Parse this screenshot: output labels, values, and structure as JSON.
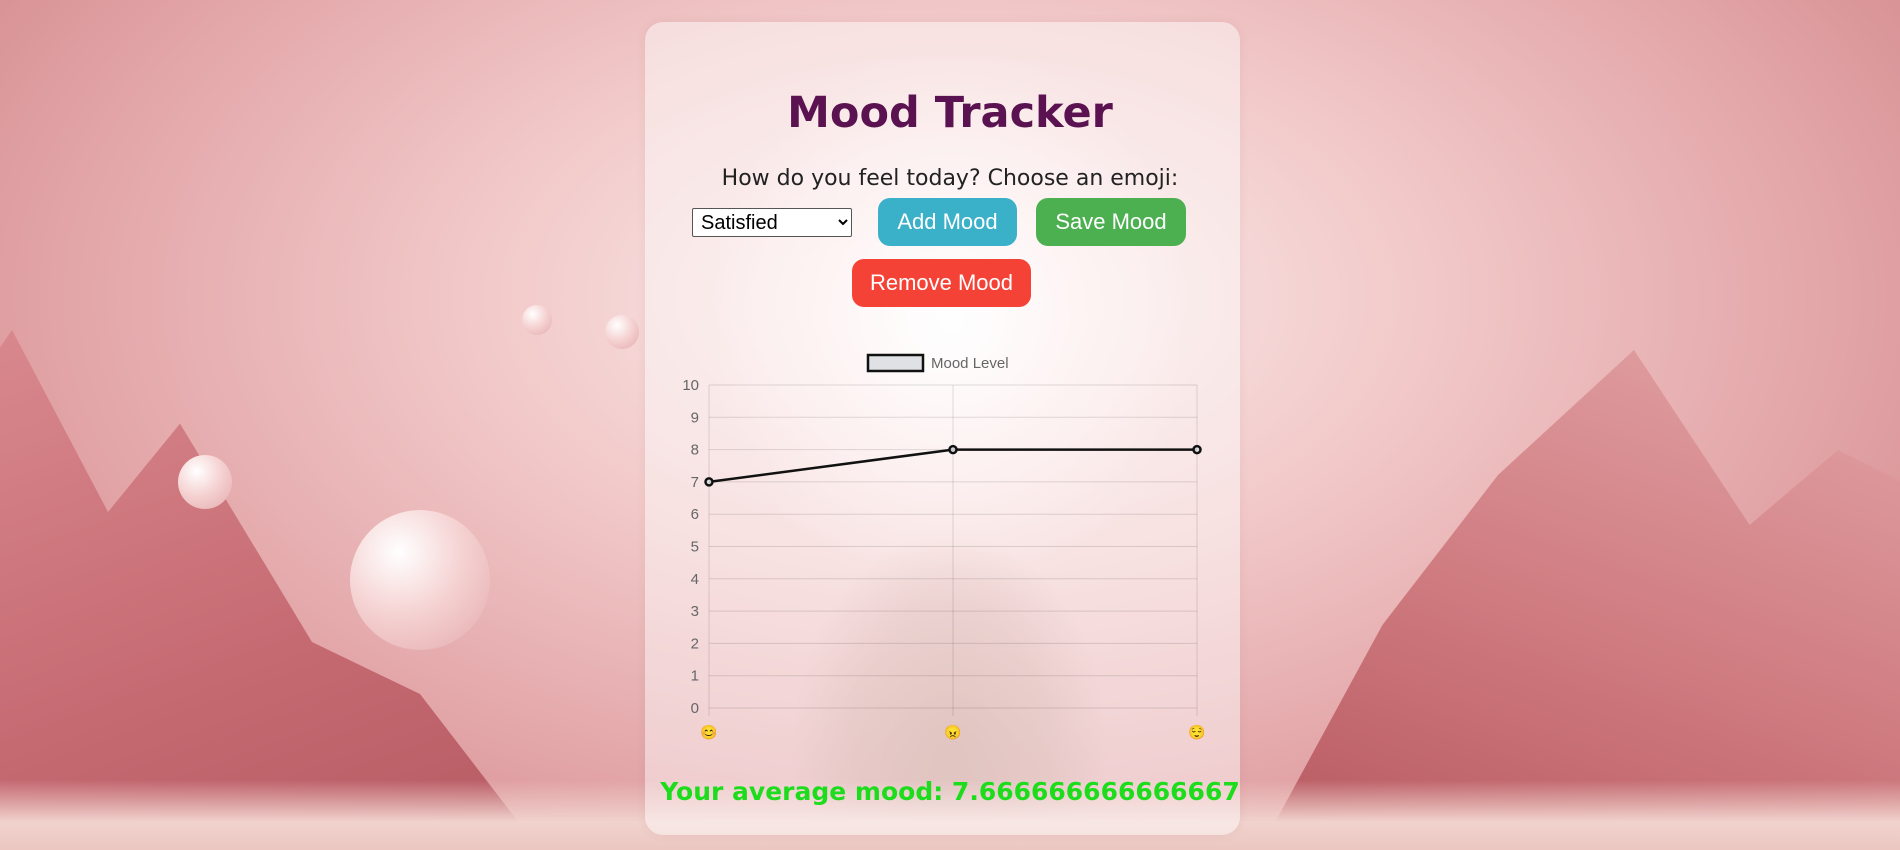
{
  "header": {
    "title": "Mood Tracker"
  },
  "form": {
    "prompt": "How do you feel today? Choose an emoji:",
    "selected_mood": "Satisfied",
    "add_label": "Add Mood",
    "save_label": "Save Mood",
    "remove_label": "Remove Mood"
  },
  "chart_data": {
    "type": "line",
    "legend": {
      "label": "Mood Level",
      "placement": "top-center"
    },
    "categories": [
      "😊",
      "😠",
      "😌"
    ],
    "series": [
      {
        "name": "Mood Level",
        "values": [
          7,
          8,
          8
        ]
      }
    ],
    "ylim": [
      0,
      10
    ],
    "y_ticks": [
      "0",
      "1",
      "2",
      "3",
      "4",
      "5",
      "6",
      "7",
      "8",
      "9",
      "10"
    ],
    "grid": true,
    "line_color": "#111111"
  },
  "summary": {
    "average_text": "Your average mood: 7.666666666666667"
  },
  "colors": {
    "title": "#5a1350",
    "add_button": "#3bb0c9",
    "save_button": "#4caf50",
    "remove_button": "#f44336",
    "average_text": "#1cdc1c"
  }
}
